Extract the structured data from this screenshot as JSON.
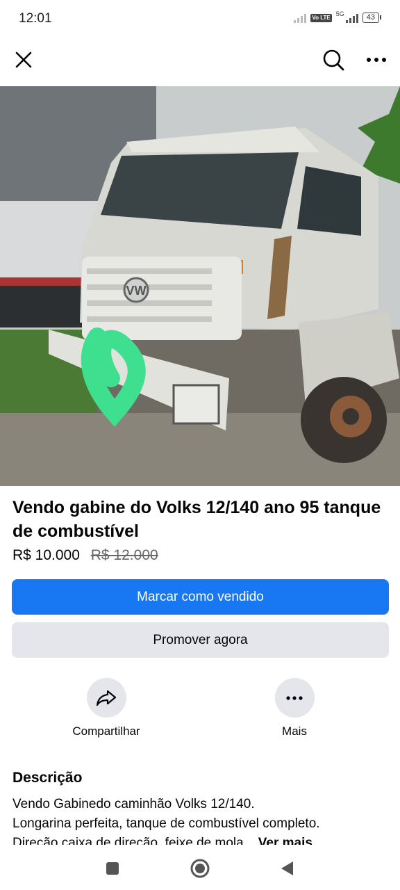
{
  "status_bar": {
    "time": "12:01",
    "network": "5G",
    "volte": "Vo LTE",
    "battery": "43"
  },
  "topbar": {
    "icons": [
      "close-icon",
      "search-icon",
      "more-icon"
    ]
  },
  "listing": {
    "title": "Vendo gabine do Volks 12/140 ano 95 tanque de combustível",
    "price": "R$ 10.000",
    "original_price": "R$ 12.000"
  },
  "buttons": {
    "mark_sold": "Marcar como vendido",
    "promote": "Promover agora"
  },
  "actions": {
    "share": "Compartilhar",
    "more": "Mais"
  },
  "description": {
    "heading": "Descrição",
    "line1": "Vendo Gabinedo caminhão Volks 12/140.",
    "line2": "Longarina perfeita, tanque de combustível completo.",
    "line3": "Direção caixa de direção, feixe de mola...",
    "see_more": "Ver mais"
  },
  "colors": {
    "primary": "#1877f2",
    "secondary": "#e4e6eb",
    "muted_text": "#65676b"
  },
  "navbar": {
    "icons": [
      "recents-icon",
      "home-icon",
      "back-icon"
    ]
  }
}
